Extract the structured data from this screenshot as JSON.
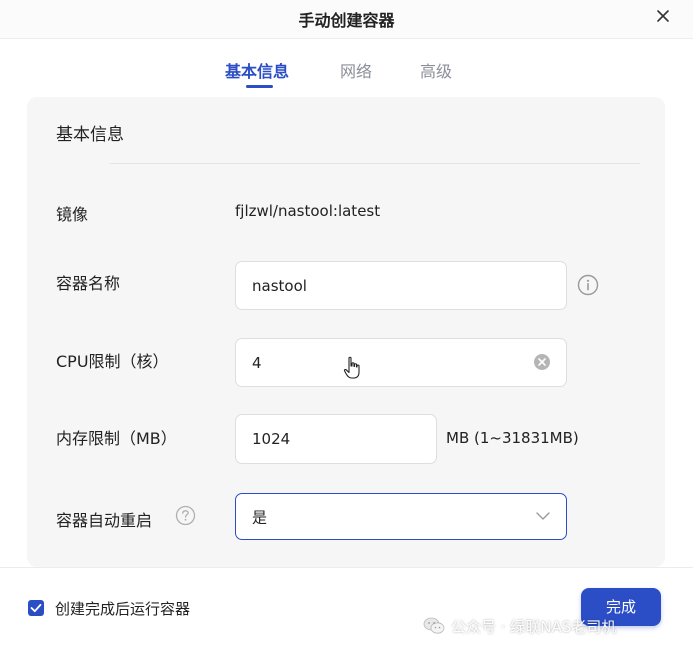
{
  "dialog": {
    "title": "手动创建容器"
  },
  "tabs": [
    {
      "label": "基本信息",
      "active": true
    },
    {
      "label": "网络",
      "active": false
    },
    {
      "label": "高级",
      "active": false
    }
  ],
  "section": {
    "title": "基本信息"
  },
  "fields": {
    "image": {
      "label": "镜像",
      "value": "fjlzwl/nastool:latest"
    },
    "container_name": {
      "label": "容器名称",
      "value": "nastool"
    },
    "cpu_limit": {
      "label": "CPU限制（核）",
      "value": "4"
    },
    "memory_limit": {
      "label": "内存限制（MB）",
      "value": "1024",
      "unit": "MB (1~31831MB)"
    },
    "auto_restart": {
      "label": "容器自动重启",
      "value": "是"
    }
  },
  "footer": {
    "run_after_create_label": "创建完成后运行容器",
    "run_after_create_checked": true,
    "done_label": "完成"
  },
  "watermark": {
    "text": "公众号 · 绿联NAS老司机"
  },
  "colors": {
    "accent": "#2b4ec7",
    "card_bg": "#f6f6f6",
    "muted": "#8a8f99"
  }
}
